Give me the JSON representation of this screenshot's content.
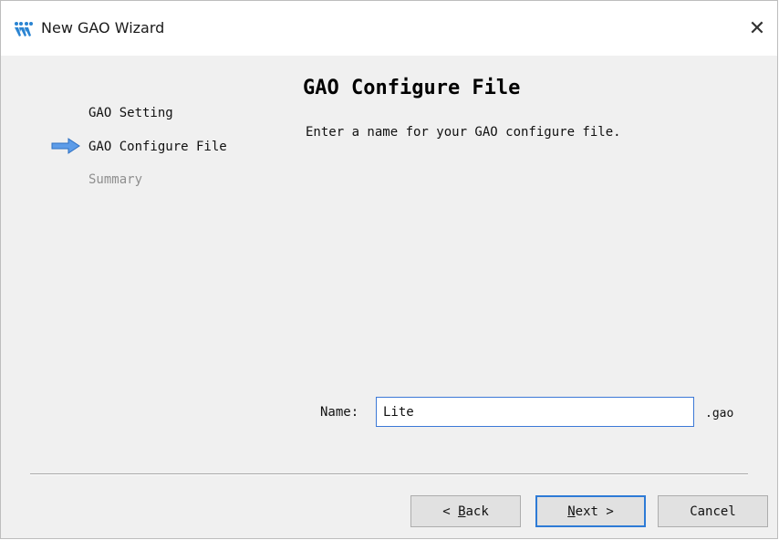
{
  "window": {
    "title": "New GAO Wizard",
    "icon": "gowin-logo-icon",
    "close_symbol": "✕"
  },
  "steps": [
    {
      "label": "GAO Setting",
      "state": "done"
    },
    {
      "label": "GAO Configure File",
      "state": "current"
    },
    {
      "label": "Summary",
      "state": "pending"
    }
  ],
  "page": {
    "heading": "GAO Configure File",
    "description": "Enter a name for your GAO configure file."
  },
  "form": {
    "name_label": "Name:",
    "name_value": "Lite",
    "extension": ".gao"
  },
  "buttons": {
    "back": {
      "prefix": "< ",
      "accel": "B",
      "rest": "ack"
    },
    "next": {
      "accel": "N",
      "rest": "ext",
      "suffix": " >"
    },
    "cancel": "Cancel"
  },
  "colors": {
    "arrow": "#4a90e2",
    "focus_border": "#2e7bd6",
    "logo": "#2a84d2"
  }
}
